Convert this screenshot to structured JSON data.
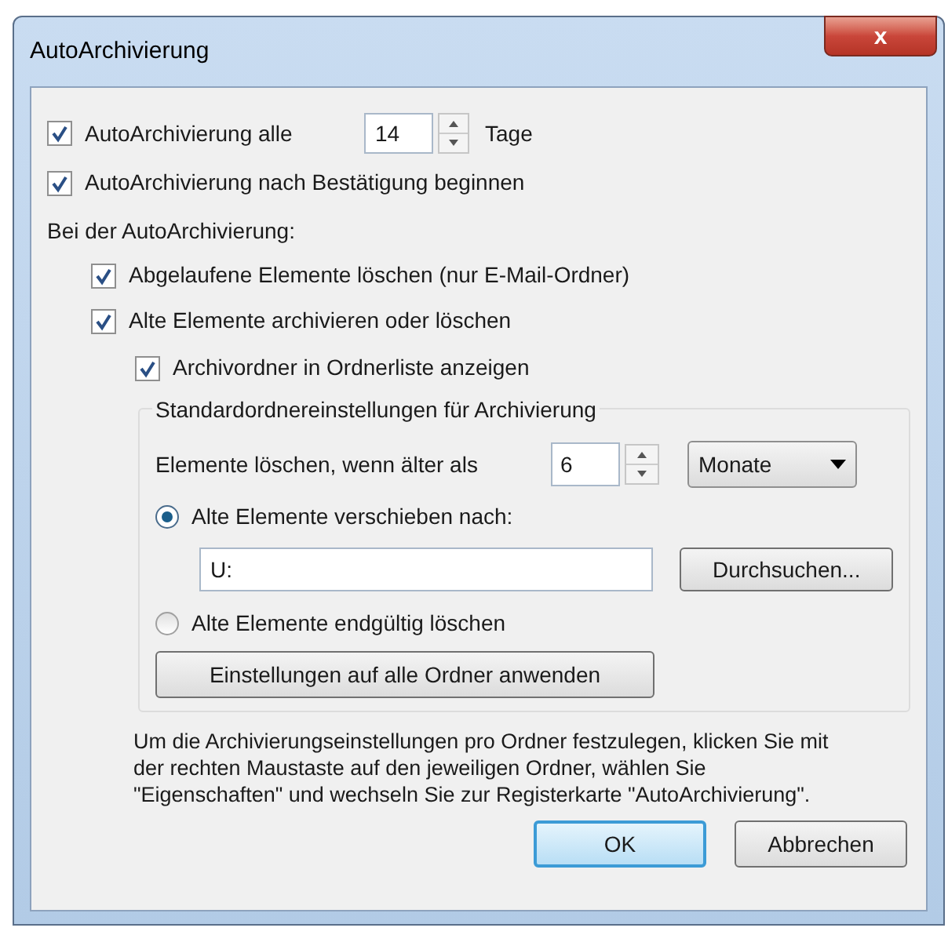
{
  "window": {
    "title": "AutoArchivierung",
    "close": "x"
  },
  "auto_archive": {
    "label": "AutoArchivierung alle",
    "checked": true,
    "days": "14",
    "unit": "Tage"
  },
  "confirm": {
    "label": "AutoArchivierung nach Bestätigung beginnen",
    "checked": true
  },
  "section_label": "Bei der AutoArchivierung:",
  "options": [
    {
      "label": "Abgelaufene Elemente löschen (nur E-Mail-Ordner)",
      "checked": true
    },
    {
      "label": "Alte Elemente archivieren oder löschen",
      "checked": true
    }
  ],
  "show_folder": {
    "label": "Archivordner in Ordnerliste anzeigen",
    "checked": true
  },
  "group": {
    "title": "Standardordnereinstellungen für Archivierung",
    "age_label": "Elemente löschen, wenn älter als",
    "age_value": "6",
    "age_unit": "Monate",
    "radios": [
      {
        "label": "Alte Elemente verschieben nach:",
        "selected": true
      },
      {
        "label": "Alte Elemente endgültig löschen",
        "selected": false
      }
    ],
    "path": "U:",
    "browse": "Durchsuchen...",
    "apply_all": "Einstellungen auf alle Ordner anwenden"
  },
  "info": "Um die Archivierungseinstellungen pro Ordner festzulegen, klicken Sie mit der rechten Maustaste auf den jeweiligen Ordner, wählen Sie \"Eigenschaften\" und wechseln Sie zur Registerkarte \"AutoArchivierung\".",
  "buttons": [
    {
      "label": "OK",
      "kind": "default"
    },
    {
      "label": "Abbrechen",
      "kind": "normal"
    }
  ]
}
